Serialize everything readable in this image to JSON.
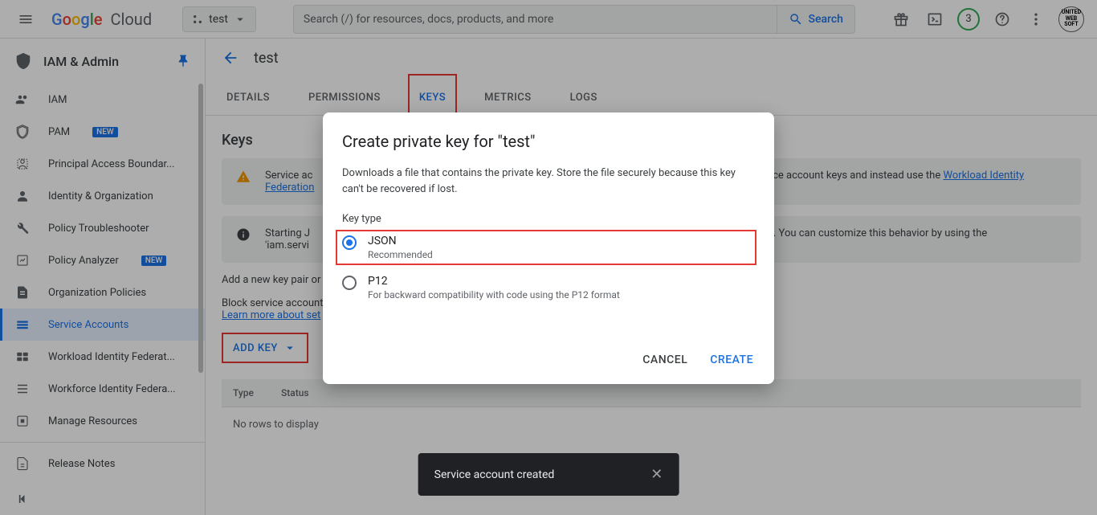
{
  "topbar": {
    "logo_cloud": "Cloud",
    "project_name": "test",
    "search_placeholder": "Search (/) for resources, docs, products, and more",
    "search_button": "Search",
    "trial_count": "3",
    "avatar_text": "UNITED WEB SOFT"
  },
  "sidebar": {
    "title": "IAM & Admin",
    "items": [
      {
        "label": "IAM",
        "icon": "people"
      },
      {
        "label": "PAM",
        "icon": "shield-outline",
        "badge": "NEW"
      },
      {
        "label": "Principal Access Boundar...",
        "icon": "boundary"
      },
      {
        "label": "Identity & Organization",
        "icon": "account"
      },
      {
        "label": "Policy Troubleshooter",
        "icon": "wrench"
      },
      {
        "label": "Policy Analyzer",
        "icon": "analyzer",
        "badge": "NEW"
      },
      {
        "label": "Organization Policies",
        "icon": "doc"
      },
      {
        "label": "Service Accounts",
        "icon": "service-account",
        "active": true
      },
      {
        "label": "Workload Identity Federat...",
        "icon": "workload"
      },
      {
        "label": "Workforce Identity Federa...",
        "icon": "workforce"
      },
      {
        "label": "Manage Resources",
        "icon": "manage"
      },
      {
        "label": "Release Notes",
        "icon": "release"
      }
    ]
  },
  "content": {
    "breadcrumb": "test",
    "tabs": [
      {
        "label": "DETAILS"
      },
      {
        "label": "PERMISSIONS"
      },
      {
        "label": "KEYS",
        "active": true,
        "highlighted": true
      },
      {
        "label": "METRICS"
      },
      {
        "label": "LOGS"
      }
    ],
    "heading": "Keys",
    "warning_text_prefix": "Service ac",
    "warning_link": "Federation",
    "warning_text_suffix": "vice account keys and instead use the ",
    "workload_link": "Workload Identity",
    "warning_trail": "e",
    "info_text_prefix": "Starting J",
    "info_text_code": "'iam.servi",
    "info_text_suffix": "es. You can customize this behavior by using the",
    "add_key_text": "Add a new key pair or",
    "block_text": "Block service account",
    "learn_more": "Learn more about set",
    "add_key_button": "ADD KEY",
    "table": {
      "col1": "Type",
      "col2": "Status",
      "empty": "No rows to display"
    }
  },
  "modal": {
    "title": "Create private key for \"test\"",
    "description": "Downloads a file that contains the private key. Store the file securely because this key can't be recovered if lost.",
    "key_type_label": "Key type",
    "options": [
      {
        "label": "JSON",
        "hint": "Recommended",
        "selected": true,
        "highlighted": true
      },
      {
        "label": "P12",
        "hint": "For backward compatibility with code using the P12 format"
      }
    ],
    "cancel": "CANCEL",
    "create": "CREATE"
  },
  "toast": {
    "message": "Service account created"
  }
}
